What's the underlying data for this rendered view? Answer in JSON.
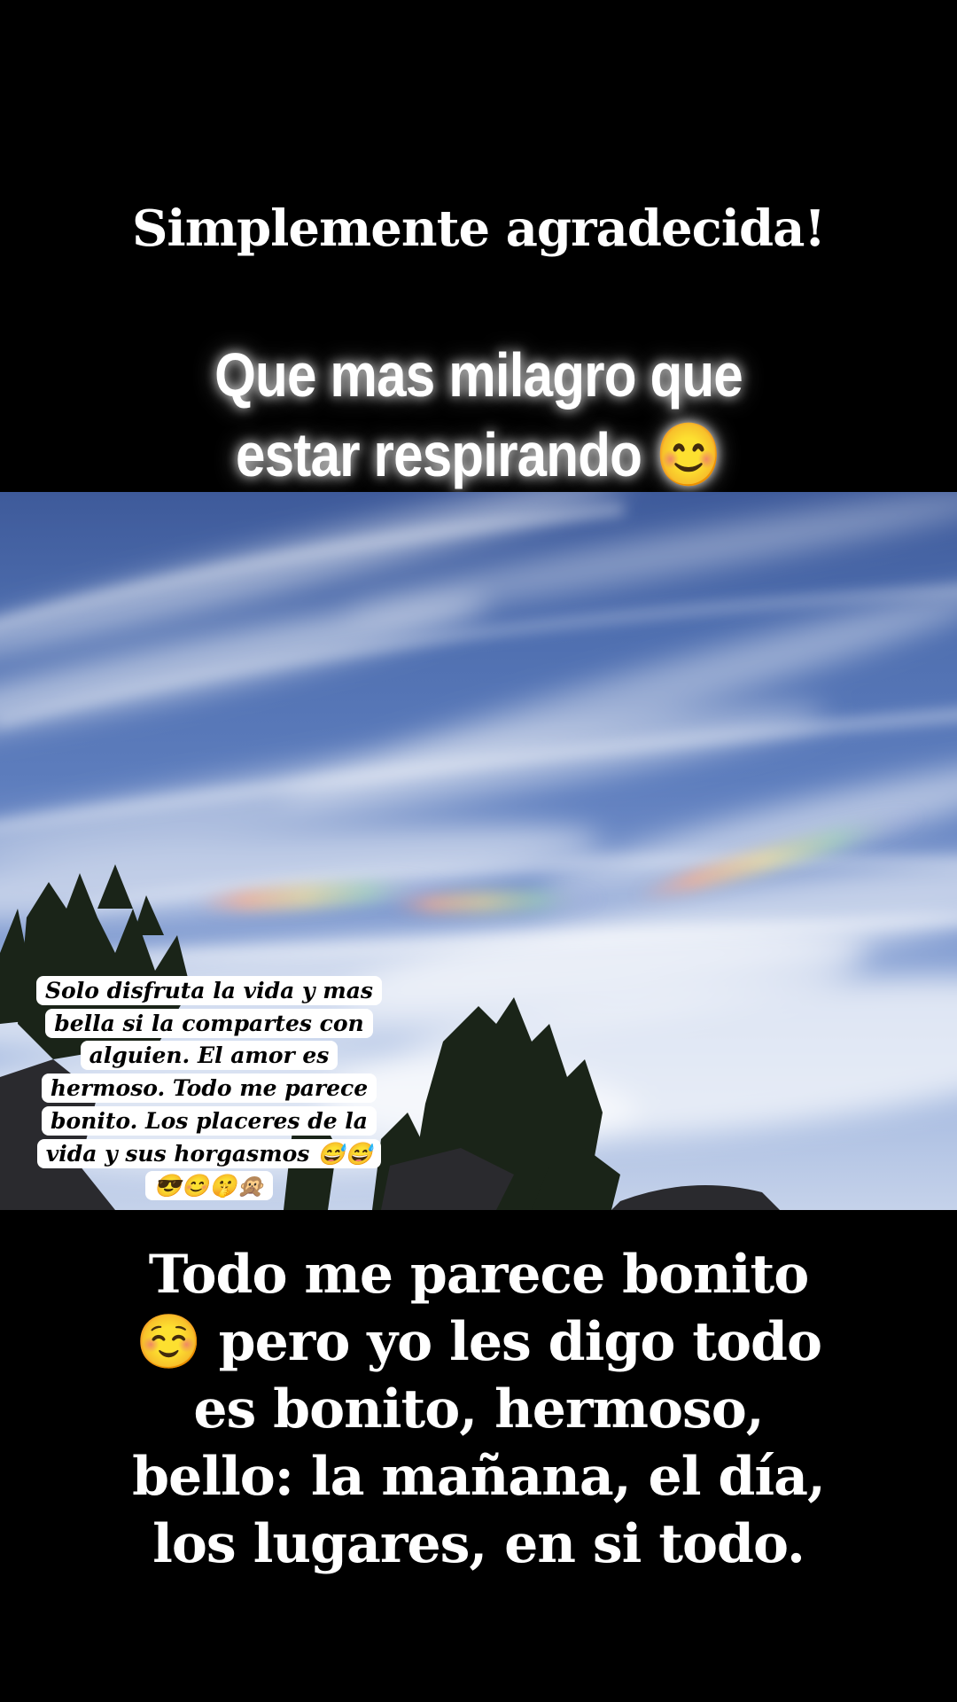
{
  "story": {
    "title": "Simplemente agradecida!",
    "subtitle": "Que mas milagro que estar respirando 😊",
    "sticker_text": "Solo disfruta la vida y mas bella si la compartes con alguien. El amor es hermoso. Todo me parece bonito. Los placeres de la vida y sus horgasmos 😅😅😎😊🤫🙊",
    "body_text": "Todo me parece bonito ☺️ pero yo les digo todo es bonito, hermoso, bello: la mañana, el día, los lugares, en si todo."
  },
  "photo": {
    "subject": "sky-with-clouds-and-pine-trees",
    "colors": {
      "sky_top": "#3e5a9a",
      "sky_bottom": "#c5d2ea",
      "trees": "#1a2418",
      "rocks": "#2a2a2e"
    }
  }
}
